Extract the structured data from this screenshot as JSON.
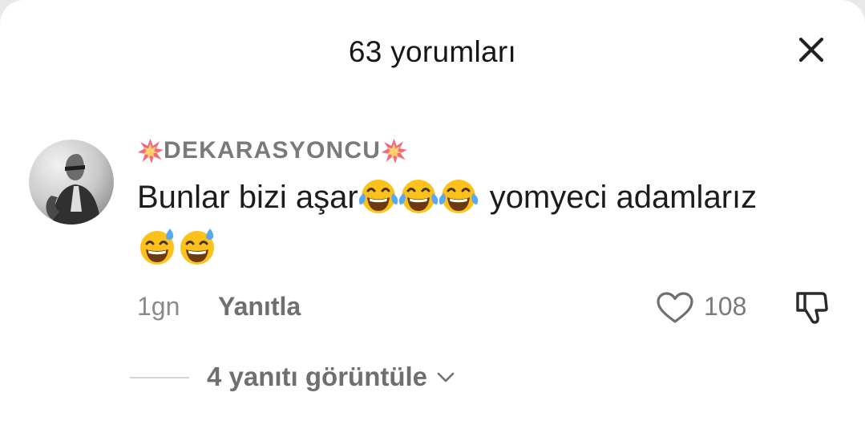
{
  "header": {
    "title": "63 yorumları"
  },
  "icons": {
    "close": "close-icon",
    "like": "heart-outline-icon",
    "dislike": "thumbs-down-icon",
    "expand": "chevron-down-icon",
    "decoration": "collision-spark-icon"
  },
  "comment": {
    "username": "DEKARASYONCU",
    "text_before_emoji": "Bunlar bizi aşar",
    "text_after_emoji": "yomyeci adamlarız",
    "emojis_line1": [
      "tears-of-joy-emoji",
      "tears-of-joy-emoji",
      "tears-of-joy-emoji"
    ],
    "emojis_line2": [
      "sweat-smile-emoji",
      "sweat-smile-emoji"
    ],
    "time": "1gn",
    "reply_label": "Yanıtla",
    "like_count": "108",
    "view_replies_label": "4 yanıtı görüntüle"
  },
  "colors": {
    "primary_text": "#161616",
    "secondary_text": "#7a7a7a",
    "background": "#ffffff"
  }
}
